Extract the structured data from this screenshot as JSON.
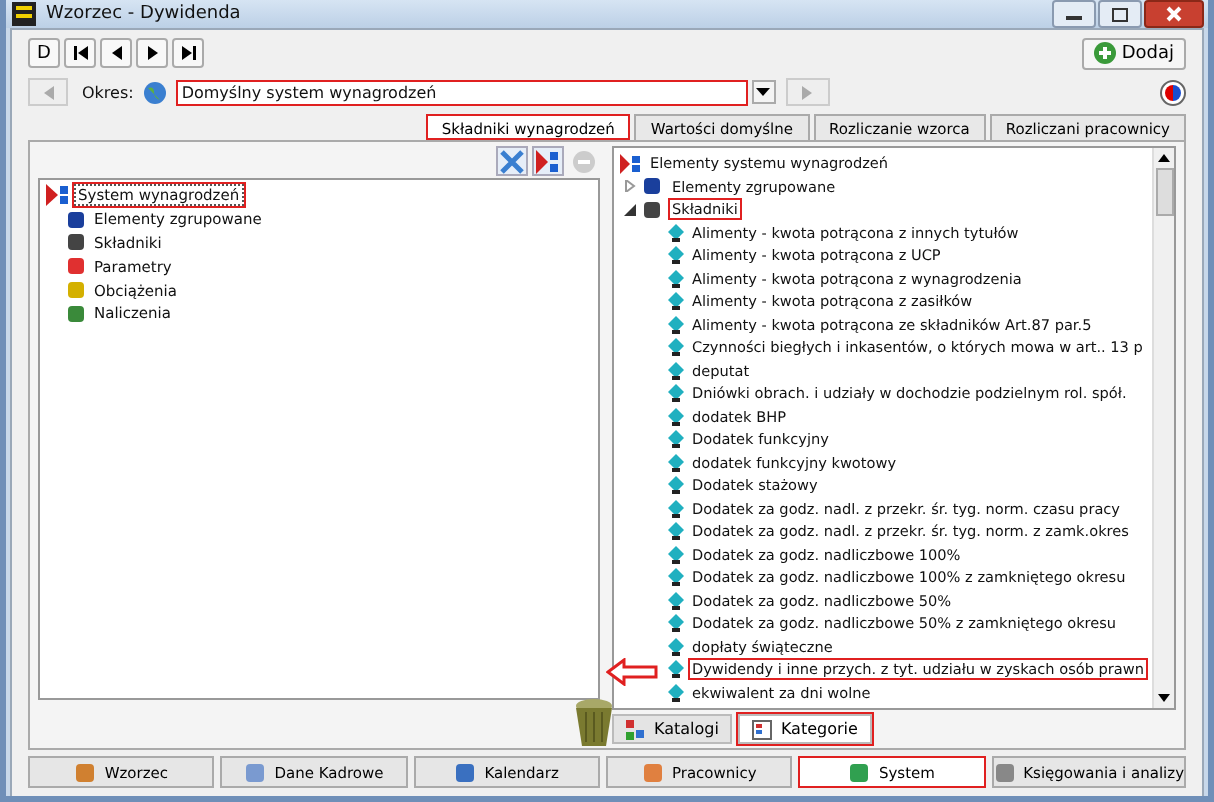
{
  "window": {
    "title": "Wzorzec - Dywidenda"
  },
  "toolbar": {
    "first_button": "D",
    "add_button": "Dodaj"
  },
  "period": {
    "label": "Okres:",
    "value": "Domyślny system wynagrodzeń",
    "highlighted": true
  },
  "tabs": [
    {
      "label": "Składniki wynagrodzeń",
      "selected": true,
      "highlighted": true
    },
    {
      "label": "Wartości domyślne",
      "selected": false,
      "highlighted": false
    },
    {
      "label": "Rozliczanie wzorca",
      "selected": false,
      "highlighted": false
    },
    {
      "label": "Rozliczani pracownicy",
      "selected": false,
      "highlighted": false
    }
  ],
  "left_tree": {
    "root": {
      "label": "System wynagrodzeń",
      "selected": true,
      "highlighted": true
    },
    "children": [
      {
        "label": "Elementy zgrupowane",
        "kind": "group"
      },
      {
        "label": "Składniki",
        "kind": "component"
      },
      {
        "label": "Parametry",
        "kind": "parameter"
      },
      {
        "label": "Obciążenia",
        "kind": "charge"
      },
      {
        "label": "Naliczenia",
        "kind": "accrual"
      }
    ]
  },
  "right_tree": {
    "root": "Elementy systemu wynagrodzeń",
    "children": [
      {
        "label": "Elementy zgrupowane",
        "kind": "group",
        "expanded": false,
        "highlighted": false
      },
      {
        "label": "Składniki",
        "kind": "component",
        "expanded": true,
        "highlighted": true,
        "children": [
          {
            "label": "Alimenty - kwota potrącona z innych tytułów",
            "highlighted": false
          },
          {
            "label": "Alimenty - kwota potrącona z UCP",
            "highlighted": false
          },
          {
            "label": "Alimenty - kwota potrącona z wynagrodzenia",
            "highlighted": false
          },
          {
            "label": "Alimenty - kwota potrącona z zasiłków",
            "highlighted": false
          },
          {
            "label": "Alimenty - kwota potrącona ze składników Art.87 par.5",
            "highlighted": false
          },
          {
            "label": "Czynności biegłych i inkasentów, o których mowa w art.. 13 p",
            "highlighted": false
          },
          {
            "label": "deputat",
            "highlighted": false
          },
          {
            "label": "Dniówki obrach. i udziały w dochodzie podzielnym rol. spół.",
            "highlighted": false
          },
          {
            "label": "dodatek BHP",
            "highlighted": false
          },
          {
            "label": "Dodatek funkcyjny",
            "highlighted": false
          },
          {
            "label": "dodatek funkcyjny kwotowy",
            "highlighted": false
          },
          {
            "label": "Dodatek stażowy",
            "highlighted": false
          },
          {
            "label": "Dodatek za godz. nadl. z przekr. śr. tyg. norm. czasu pracy",
            "highlighted": false
          },
          {
            "label": "Dodatek za godz. nadl. z przekr. śr. tyg. norm. z zamk.okres",
            "highlighted": false
          },
          {
            "label": "Dodatek za godz. nadliczbowe 100%",
            "highlighted": false
          },
          {
            "label": "Dodatek za godz. nadliczbowe 100% z zamkniętego okresu",
            "highlighted": false
          },
          {
            "label": "Dodatek za godz. nadliczbowe 50%",
            "highlighted": false
          },
          {
            "label": "Dodatek za godz. nadliczbowe 50% z zamkniętego okresu",
            "highlighted": false
          },
          {
            "label": "dopłaty świąteczne",
            "highlighted": false
          },
          {
            "label": "Dywidendy i inne przych. z tyt. udziału w zyskach osób prawn",
            "highlighted": true
          },
          {
            "label": "ekwiwalent za dni wolne",
            "highlighted": false
          }
        ]
      }
    ]
  },
  "view_tabs": [
    {
      "label": "Katalogi",
      "selected": false,
      "highlighted": false
    },
    {
      "label": "Kategorie",
      "selected": true,
      "highlighted": true
    }
  ],
  "nav": [
    {
      "label": "Wzorzec",
      "selected": false,
      "highlighted": false
    },
    {
      "label": "Dane Kadrowe",
      "selected": false,
      "highlighted": false
    },
    {
      "label": "Kalendarz",
      "selected": false,
      "highlighted": false
    },
    {
      "label": "Pracownicy",
      "selected": false,
      "highlighted": false
    },
    {
      "label": "System",
      "selected": true,
      "highlighted": true
    },
    {
      "label": "Księgowania i analizy",
      "selected": false,
      "highlighted": false
    }
  ]
}
